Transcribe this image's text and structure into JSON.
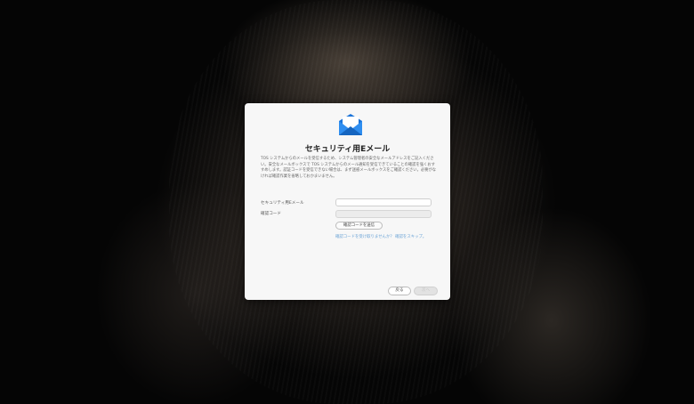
{
  "dialog": {
    "title": "セキュリティ用Eメール",
    "description": "TOS システムからのメールを受信するため、システム管理者の安全なメールアドレスをご記入ください。安全なメールボックスで TOS システムからのメール通知を受信できていることの確認を強くおすすめします。認証コードを受信できない場合は、まず迷惑メールボックスをご確認ください。必要がなければ確認作業を省略しておかまいません。",
    "fields": {
      "email_label": "セキュリティ用Eメール",
      "email_value": "",
      "code_label": "確認コード",
      "code_value": ""
    },
    "send_button": "確認コードを送信",
    "link_not_received": "確認コードを受け取りませんか？",
    "link_skip": "確認をスキップ。",
    "back_button": "戻る",
    "next_button": "次へ",
    "icon": "envelope-icon",
    "accent_color": "#1a73d9"
  }
}
